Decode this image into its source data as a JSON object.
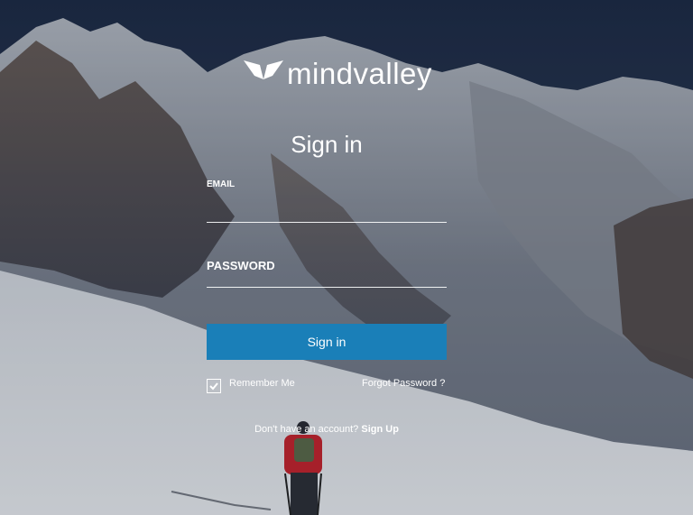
{
  "brand": {
    "logo_text": "mindvalley",
    "logo_icon": "butterfly-wings-icon"
  },
  "form": {
    "title": "Sign in",
    "email": {
      "label": "EMAIL",
      "value": ""
    },
    "password": {
      "label": "PASSWORD",
      "value": ""
    },
    "submit_label": "Sign in",
    "remember": {
      "label": "Remember Me",
      "checked": true
    },
    "forgot_label": "Forgot Password ?",
    "signup_prompt": "Don't have an account?",
    "signup_label": "Sign Up"
  },
  "colors": {
    "accent": "#1a7fb8",
    "text": "#ffffff",
    "background_sky": "#2a3a4f"
  }
}
